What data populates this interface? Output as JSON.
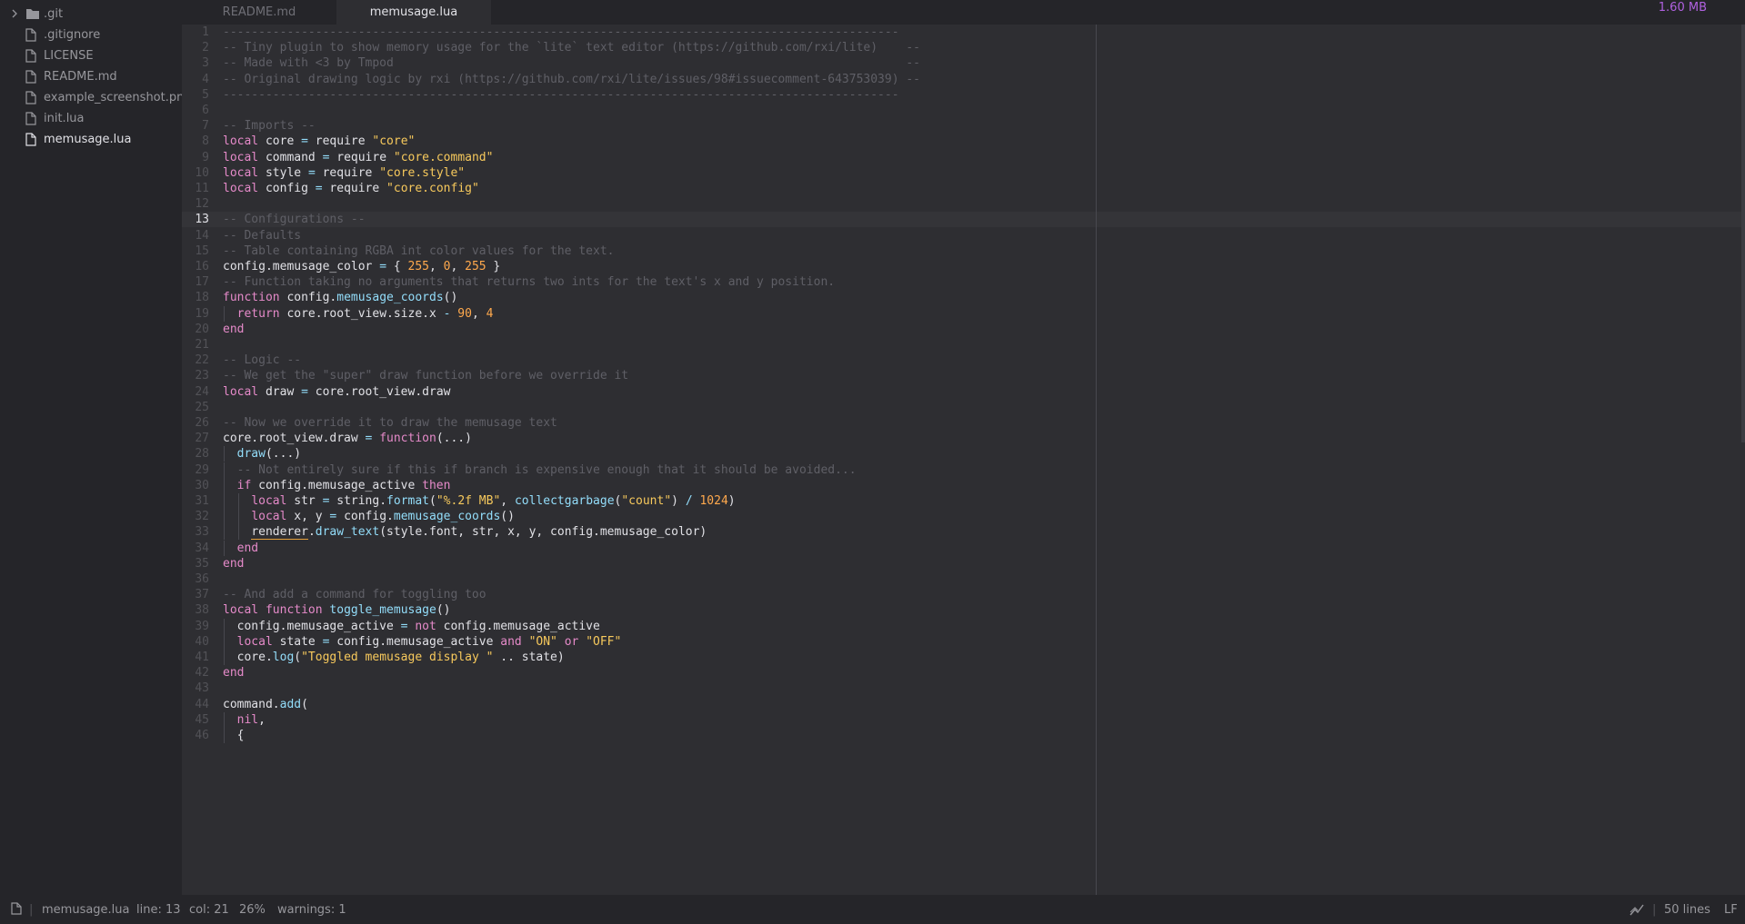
{
  "sidebar": {
    "items": [
      {
        "label": ".git",
        "type": "folder",
        "icon": "folder-icon",
        "expandable": true
      },
      {
        "label": ".gitignore",
        "type": "file",
        "icon": "file-icon"
      },
      {
        "label": "LICENSE",
        "type": "file",
        "icon": "file-icon"
      },
      {
        "label": "README.md",
        "type": "file",
        "icon": "file-icon"
      },
      {
        "label": "example_screenshot.png",
        "type": "file",
        "icon": "file-icon"
      },
      {
        "label": "init.lua",
        "type": "file",
        "icon": "file-icon"
      },
      {
        "label": "memusage.lua",
        "type": "file",
        "icon": "file-icon",
        "active": true
      }
    ]
  },
  "tabs": [
    {
      "label": "README.md",
      "active": false
    },
    {
      "label": "memusage.lua",
      "active": true
    }
  ],
  "memusage_display": "1.60 MB",
  "editor": {
    "current_line": 13,
    "lines": [
      {
        "n": "1",
        "t": "-----------------------------------------------------------------------------------------------"
      },
      {
        "n": "2",
        "t": "-- Tiny plugin to show memory usage for the `lite` text editor (https://github.com/rxi/lite)    --"
      },
      {
        "n": "3",
        "t": "-- Made with <3 by Tmpod                                                                        --"
      },
      {
        "n": "4",
        "t": "-- Original drawing logic by rxi (https://github.com/rxi/lite/issues/98#issuecomment-643753039) --"
      },
      {
        "n": "5",
        "t": "-----------------------------------------------------------------------------------------------"
      },
      {
        "n": "6",
        "t": ""
      },
      {
        "n": "7",
        "t": "-- Imports --"
      },
      {
        "n": "8",
        "t": "local core = require \"core\""
      },
      {
        "n": "9",
        "t": "local command = require \"core.command\""
      },
      {
        "n": "10",
        "t": "local style = require \"core.style\""
      },
      {
        "n": "11",
        "t": "local config = require \"core.config\""
      },
      {
        "n": "12",
        "t": ""
      },
      {
        "n": "13",
        "t": "-- Configurations --"
      },
      {
        "n": "14",
        "t": "-- Defaults"
      },
      {
        "n": "15",
        "t": "-- Table containing RGBA int color values for the text."
      },
      {
        "n": "16",
        "t": "config.memusage_color = { 255, 0, 255 }"
      },
      {
        "n": "17",
        "t": "-- Function taking no arguments that returns two ints for the text's x and y position."
      },
      {
        "n": "18",
        "t": "function config.memusage_coords()"
      },
      {
        "n": "19",
        "t": "  return core.root_view.size.x - 90, 4"
      },
      {
        "n": "20",
        "t": "end"
      },
      {
        "n": "21",
        "t": ""
      },
      {
        "n": "22",
        "t": "-- Logic --"
      },
      {
        "n": "23",
        "t": "-- We get the \"super\" draw function before we override it"
      },
      {
        "n": "24",
        "t": "local draw = core.root_view.draw"
      },
      {
        "n": "25",
        "t": ""
      },
      {
        "n": "26",
        "t": "-- Now we override it to draw the memusage text"
      },
      {
        "n": "27",
        "t": "core.root_view.draw = function(...)"
      },
      {
        "n": "28",
        "t": "  draw(...)"
      },
      {
        "n": "29",
        "t": "  -- Not entirely sure if this if branch is expensive enough that it should be avoided..."
      },
      {
        "n": "30",
        "t": "  if config.memusage_active then"
      },
      {
        "n": "31",
        "t": "    local str = string.format(\"%.2f MB\", collectgarbage(\"count\") / 1024)"
      },
      {
        "n": "32",
        "t": "    local x, y = config.memusage_coords()"
      },
      {
        "n": "33",
        "t": "    renderer.draw_text(style.font, str, x, y, config.memusage_color)"
      },
      {
        "n": "34",
        "t": "  end"
      },
      {
        "n": "35",
        "t": "end"
      },
      {
        "n": "36",
        "t": ""
      },
      {
        "n": "37",
        "t": "-- And add a command for toggling too"
      },
      {
        "n": "38",
        "t": "local function toggle_memusage()"
      },
      {
        "n": "39",
        "t": "  config.memusage_active = not config.memusage_active"
      },
      {
        "n": "40",
        "t": "  local state = config.memusage_active and \"ON\" or \"OFF\""
      },
      {
        "n": "41",
        "t": "  core.log(\"Toggled memusage display \" .. state)"
      },
      {
        "n": "42",
        "t": "end"
      },
      {
        "n": "43",
        "t": ""
      },
      {
        "n": "44",
        "t": "command.add("
      },
      {
        "n": "45",
        "t": "  nil,"
      },
      {
        "n": "46",
        "t": "  {"
      }
    ]
  },
  "statusbar": {
    "file_icon": "file-icon",
    "filename": "memusage.lua",
    "line": "line: 13",
    "col": "col: 21",
    "percent": "26%",
    "warnings": "warnings: 1",
    "graph_icon": "graph-icon",
    "lines": "50 lines",
    "line_ending": "LF"
  },
  "colors": {
    "background": "#2e2e32",
    "sidebar": "#252529",
    "comment": "#5f5f66",
    "keyword": "#e58ac9",
    "string": "#f7c95c",
    "number": "#ffa94d",
    "function": "#93ddfa",
    "memusage": "#b061e0"
  }
}
